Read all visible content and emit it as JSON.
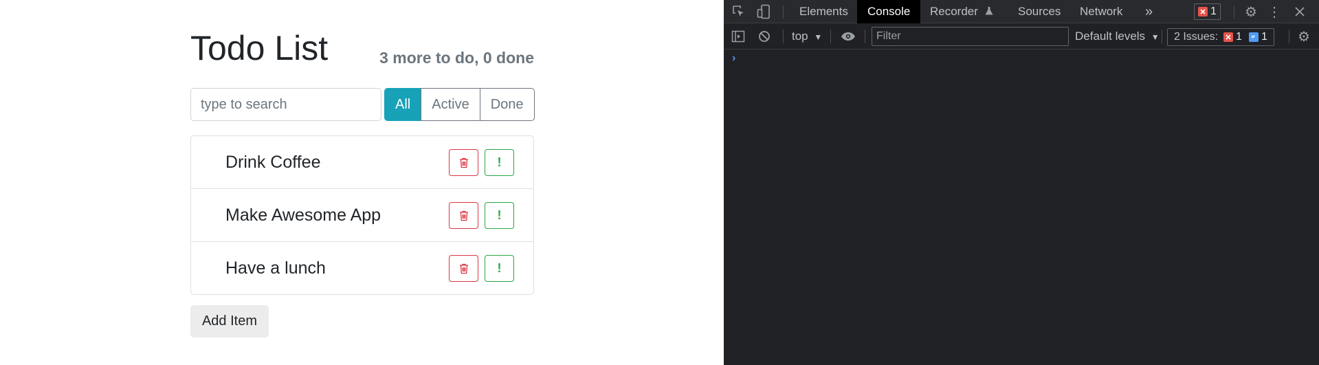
{
  "app": {
    "title": "Todo List",
    "counter": "3 more to do, 0 done",
    "search": {
      "placeholder": "type to search",
      "value": ""
    },
    "filters": [
      {
        "label": "All",
        "active": true
      },
      {
        "label": "Active",
        "active": false
      },
      {
        "label": "Done",
        "active": false
      }
    ],
    "items": [
      {
        "label": "Drink Coffee"
      },
      {
        "label": "Make Awesome App"
      },
      {
        "label": "Have a lunch"
      }
    ],
    "item_buttons": {
      "delete_icon": "trash-icon",
      "important_icon": "exclamation-icon",
      "important_glyph": "!"
    },
    "add_button": "Add Item",
    "colors": {
      "accent": "#17a2b8",
      "danger": "#dc3545",
      "success": "#28a745",
      "muted": "#6c757d"
    }
  },
  "devtools": {
    "tabs": [
      "Elements",
      "Console",
      "Recorder",
      "Sources",
      "Network"
    ],
    "active_tab": "Console",
    "more_tabs_glyph": "»",
    "error_count": "1",
    "context": "top",
    "filter_placeholder": "Filter",
    "levels": "Default levels",
    "issues": {
      "label": "2 Issues:",
      "errors": "1",
      "messages": "1"
    },
    "prompt_glyph": "›",
    "colors": {
      "background": "#202124",
      "error": "#f28b82",
      "info": "#8ab4f8"
    }
  }
}
